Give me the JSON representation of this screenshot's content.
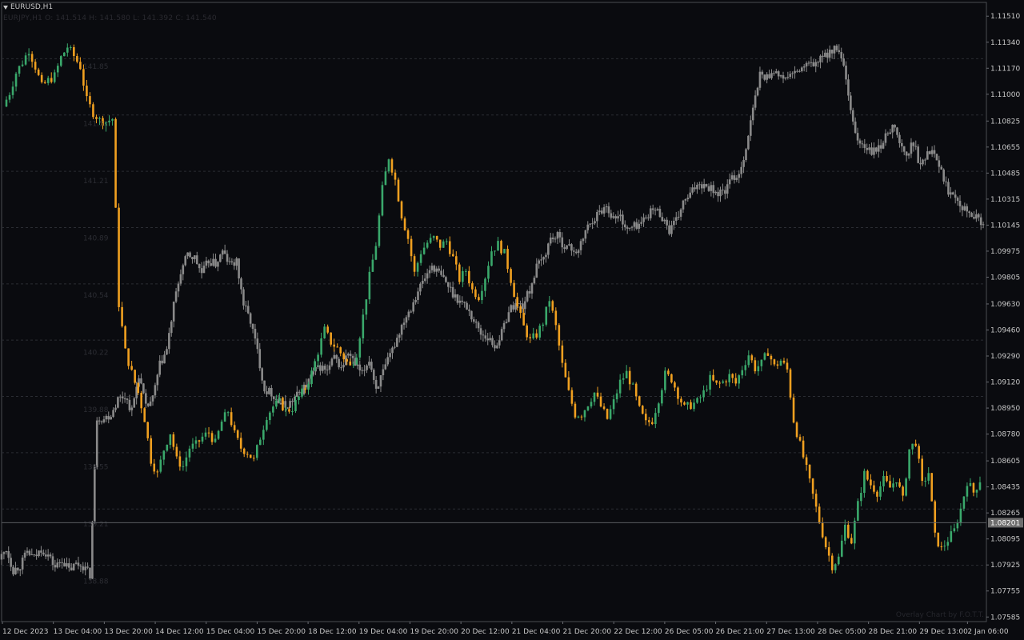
{
  "window": {
    "symbol_label": "EURUSD,H1",
    "ohlc_readout": "EURJPY,H1  O: 141.514  H: 141.580  L: 141.392  C: 141.540",
    "watermark": "Overlay Chart by F.O.T.T."
  },
  "colors": {
    "background": "#0a0b0f",
    "axis_text": "#c8c8c8",
    "grid": "#2b2d33",
    "bull": "#3aa86b",
    "bear": "#f0a020",
    "overlay": "#8a8a8a",
    "price_tag_bg": "#6e6e6e"
  },
  "chart_data": {
    "type": "candlestick",
    "title": "EURUSD,H1",
    "ylim": [
      1.07555,
      1.116
    ],
    "right_axis_ticks": [
      "1.11510",
      "1.11340",
      "1.11170",
      "1.11000",
      "1.10825",
      "1.10655",
      "1.10485",
      "1.10315",
      "1.10145",
      "1.09975",
      "1.09805",
      "1.09630",
      "1.09460",
      "1.09290",
      "1.09120",
      "1.08950",
      "1.08780",
      "1.08605",
      "1.08435",
      "1.08265",
      "1.08095",
      "1.07925",
      "1.07755",
      "1.07585"
    ],
    "right_axis_values": [
      1.1151,
      1.1134,
      1.1117,
      1.11,
      1.10825,
      1.10655,
      1.10485,
      1.10315,
      1.10145,
      1.09975,
      1.09805,
      1.0963,
      1.0946,
      1.0929,
      1.0912,
      1.0895,
      1.0878,
      1.08605,
      1.08435,
      1.08265,
      1.08095,
      1.07925,
      1.07755,
      1.07585
    ],
    "current_price": "1.08201",
    "current_price_value": 1.08201,
    "x_labels": [
      "12 Dec 2023",
      "13 Dec 04:00",
      "13 Dec 20:00",
      "14 Dec 12:00",
      "15 Dec 04:00",
      "15 Dec 20:00",
      "18 Dec 12:00",
      "19 Dec 04:00",
      "19 Dec 20:00",
      "20 Dec 12:00",
      "21 Dec 04:00",
      "21 Dec 20:00",
      "22 Dec 12:00",
      "26 Dec 05:00",
      "26 Dec 21:00",
      "27 Dec 13:00",
      "28 Dec 05:00",
      "28 Dec 21:00",
      "29 Dec 13:00",
      "2 Jan 06:00"
    ],
    "overlay_axis_values": [
      141.85,
      141.52,
      141.21,
      140.89,
      140.54,
      140.22,
      139.88,
      139.55,
      139.21,
      138.88
    ],
    "overlay_axis_ticks": [
      "141.85",
      "141.52",
      "141.21",
      "140.89",
      "140.54",
      "140.22",
      "139.88",
      "139.55",
      "139.21",
      "138.88"
    ],
    "main_series": {
      "name": "EURUSD",
      "close_path": [
        1.1092,
        1.1101,
        1.1114,
        1.1121,
        1.1129,
        1.1118,
        1.1105,
        1.1109,
        1.1112,
        1.1124,
        1.1131,
        1.1125,
        1.1118,
        1.1096,
        1.1088,
        1.1083,
        1.1082,
        1.1084,
        1.0963,
        1.0932,
        1.0918,
        1.0905,
        1.0888,
        1.0861,
        1.0852,
        1.0868,
        1.0879,
        1.0861,
        1.0857,
        1.0869,
        1.0871,
        1.0876,
        1.0879,
        1.0872,
        1.0886,
        1.0893,
        1.0878,
        1.0869,
        1.0866,
        1.0861,
        1.0876,
        1.089,
        1.0896,
        1.0899,
        1.0893,
        1.0895,
        1.0902,
        1.0908,
        1.0918,
        1.0932,
        1.0946,
        1.0938,
        1.0934,
        1.0928,
        1.0922,
        1.0931,
        1.0955,
        1.0981,
        1.1002,
        1.1038,
        1.1059,
        1.1044,
        1.1021,
        1.1006,
        1.0983,
        1.0997,
        1.1003,
        1.1006,
        1.1001,
        1.1004,
        1.0993,
        1.0979,
        1.0985,
        1.0972,
        1.0968,
        1.0981,
        1.0998,
        1.1002,
        1.0996,
        1.0979,
        1.0961,
        1.0948,
        1.0939,
        1.0943,
        1.0951,
        1.0966,
        1.0948,
        1.0923,
        1.0905,
        1.0891,
        1.0891,
        1.0898,
        1.0905,
        1.0896,
        1.0888,
        1.0899,
        1.0912,
        1.0918,
        1.0908,
        1.0894,
        1.0885,
        1.0887,
        1.0901,
        1.0917,
        1.0914,
        1.0904,
        1.0895,
        1.0897,
        1.0899,
        1.0905,
        1.0914,
        1.091,
        1.0912,
        1.0916,
        1.0911,
        1.0921,
        1.093,
        1.0921,
        1.0924,
        1.0932,
        1.0922,
        1.0926,
        1.092,
        1.0887,
        1.0871,
        1.0855,
        1.0838,
        1.0821,
        1.0805,
        1.0792,
        1.0797,
        1.0818,
        1.0808,
        1.0832,
        1.0852,
        1.0845,
        1.084,
        1.0848,
        1.0843,
        1.0849,
        1.0835,
        1.0868,
        1.0873,
        1.0845,
        1.0853,
        1.0811,
        1.0803,
        1.0809,
        1.0815,
        1.0829,
        1.0847,
        1.084,
        1.0848
      ],
      "x_range": [
        8,
        1229
      ]
    },
    "overlay_series": {
      "name": "EURJPY",
      "close_path": [
        1.0796,
        1.0803,
        1.0789,
        1.0792,
        1.0801,
        1.0797,
        1.0803,
        1.0799,
        1.0791,
        1.0796,
        1.0789,
        1.0793,
        1.0792,
        1.0786,
        1.0889,
        1.0888,
        1.0891,
        1.0901,
        1.0903,
        1.0893,
        1.0917,
        1.0895,
        1.0901,
        1.0923,
        1.0933,
        1.0962,
        1.0984,
        1.0995,
        1.0993,
        1.0983,
        1.0991,
        1.0989,
        1.0997,
        1.0989,
        1.099,
        1.0963,
        1.0952,
        1.0932,
        1.0907,
        1.0905,
        1.0899,
        1.0896,
        1.09,
        1.0905,
        1.091,
        1.0918,
        1.0922,
        1.0919,
        1.0928,
        1.0921,
        1.0931,
        1.0923,
        1.0917,
        1.0927,
        1.0908,
        1.0918,
        1.0929,
        1.0941,
        1.0953,
        1.0961,
        1.0972,
        1.098,
        1.0988,
        1.0983,
        1.0977,
        1.097,
        1.0965,
        1.0961,
        1.0952,
        1.0944,
        1.0941,
        1.0935,
        1.0944,
        1.0959,
        1.0963,
        1.0962,
        1.0972,
        1.0987,
        1.0993,
        1.1006,
        1.1007,
        1.1001,
        1.0999,
        1.0997,
        1.1011,
        1.1018,
        1.1023,
        1.1027,
        1.1019,
        1.102,
        1.1011,
        1.1014,
        1.1016,
        1.1022,
        1.1025,
        1.102,
        1.1011,
        1.1017,
        1.1029,
        1.1034,
        1.1042,
        1.1041,
        1.1039,
        1.1035,
        1.1037,
        1.1045,
        1.1048,
        1.1065,
        1.109,
        1.1113,
        1.1111,
        1.1116,
        1.111,
        1.1112,
        1.1113,
        1.1117,
        1.1119,
        1.112,
        1.1124,
        1.1128,
        1.113,
        1.1118,
        1.1087,
        1.107,
        1.1065,
        1.1062,
        1.1064,
        1.1072,
        1.1081,
        1.1068,
        1.1059,
        1.1069,
        1.1052,
        1.1063,
        1.1064,
        1.1049,
        1.1037,
        1.1035,
        1.1027,
        1.1024,
        1.1019,
        1.1016
      ],
      "x_range": [
        2,
        1232
      ]
    }
  }
}
